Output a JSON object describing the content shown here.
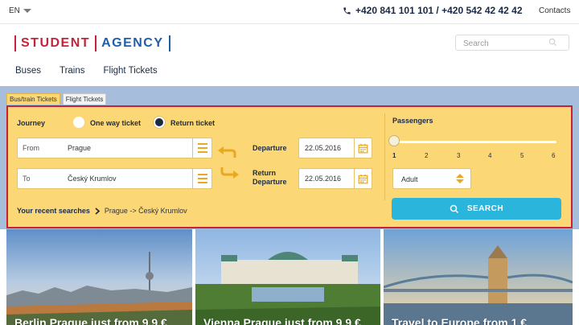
{
  "topbar": {
    "language": "EN",
    "phone": "+420 841 101 101 / +420 542 42 42 42",
    "contacts": "Contacts"
  },
  "header": {
    "logo_left": "STUDENT",
    "logo_right": "AGENCY",
    "search_placeholder": "Search"
  },
  "nav": [
    "Buses",
    "Trains",
    "Flight Tickets"
  ],
  "tabs": [
    {
      "label": "Bus/train Tickets",
      "active": true
    },
    {
      "label": "Flight Tickets",
      "active": false
    }
  ],
  "form": {
    "journey_label": "Journey",
    "one_way_label": "One way ticket",
    "return_label": "Return ticket",
    "selected_journey": "return",
    "from_label": "From",
    "from_value": "Prague",
    "to_label": "To",
    "to_value": "Český Krumlov",
    "departure_label": "Departure",
    "departure_date": "22.05.2016",
    "return_departure_label_1": "Return",
    "return_departure_label_2": "Departure",
    "return_date": "22.05.2016",
    "recent_label": "Your recent searches",
    "recent_value": "Prague -> Český Krumlov"
  },
  "passengers": {
    "label": "Passengers",
    "scale": [
      "1",
      "2",
      "3",
      "4",
      "5",
      "6"
    ],
    "selected": 1,
    "type_value": "Adult"
  },
  "search_button": "SEARCH",
  "tiles": [
    {
      "caption": "Berlin  Prague just from 9.9 €"
    },
    {
      "caption": "Vienna  Prague just from 9.9 €"
    },
    {
      "caption": "Travel to Europe from 1 €"
    }
  ],
  "colors": {
    "panel": "#fbd776",
    "panel_border": "#cc2030",
    "band": "#a6bedc",
    "search_button": "#29b5dc",
    "logo_red": "#c4243b",
    "logo_blue": "#1f5fa8"
  }
}
